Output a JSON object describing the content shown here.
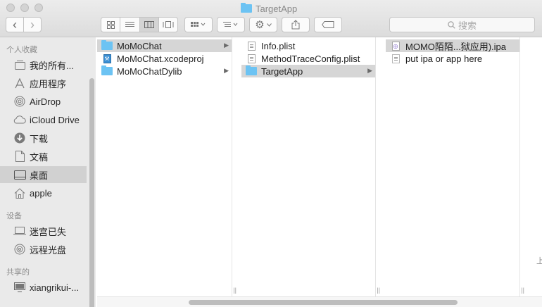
{
  "window": {
    "title": "TargetApp",
    "search_placeholder": "搜索"
  },
  "toolbar": {
    "back": "‹",
    "forward": "›",
    "view_modes": [
      "icon",
      "list",
      "column",
      "cover-flow"
    ],
    "active_view": "column"
  },
  "sidebar": {
    "favorites_header": "个人收藏",
    "favorites": [
      {
        "label": "我的所有...",
        "icon": "all-files-icon"
      },
      {
        "label": "应用程序",
        "icon": "applications-icon"
      },
      {
        "label": "AirDrop",
        "icon": "airdrop-icon"
      },
      {
        "label": "iCloud Drive",
        "icon": "cloud-icon"
      },
      {
        "label": "下载",
        "icon": "downloads-icon"
      },
      {
        "label": "文稿",
        "icon": "documents-icon"
      },
      {
        "label": "桌面",
        "icon": "desktop-icon",
        "selected": true
      },
      {
        "label": "apple",
        "icon": "home-icon"
      }
    ],
    "devices_header": "设备",
    "devices": [
      {
        "label": "迷宫已失",
        "icon": "laptop-icon"
      },
      {
        "label": "远程光盘",
        "icon": "disc-icon"
      }
    ],
    "shared_header": "共享的",
    "shared": [
      {
        "label": "xiangrikui-...",
        "icon": "computer-icon"
      }
    ]
  },
  "columns": [
    {
      "items": [
        {
          "label": "MoMoChat",
          "type": "folder",
          "selected": true,
          "has_children": true
        },
        {
          "label": "MoMoChat.xcodeproj",
          "type": "xcodeproj"
        },
        {
          "label": "MoMoChatDylib",
          "type": "folder",
          "has_children": true
        }
      ]
    },
    {
      "items": [
        {
          "label": "Info.plist",
          "type": "plist"
        },
        {
          "label": "MethodTraceConfig.plist",
          "type": "plist"
        },
        {
          "label": "TargetApp",
          "type": "folder",
          "selected": true,
          "has_children": true
        }
      ]
    },
    {
      "items": [
        {
          "label": "MOMO陌陌...狱应用).ipa",
          "type": "ipa",
          "selected": true
        },
        {
          "label": "put ipa or app here",
          "type": "blank"
        }
      ]
    }
  ],
  "edge_char": "上",
  "colors": {
    "folder": "#6cc3f3",
    "selection": "#d6d6d6"
  }
}
